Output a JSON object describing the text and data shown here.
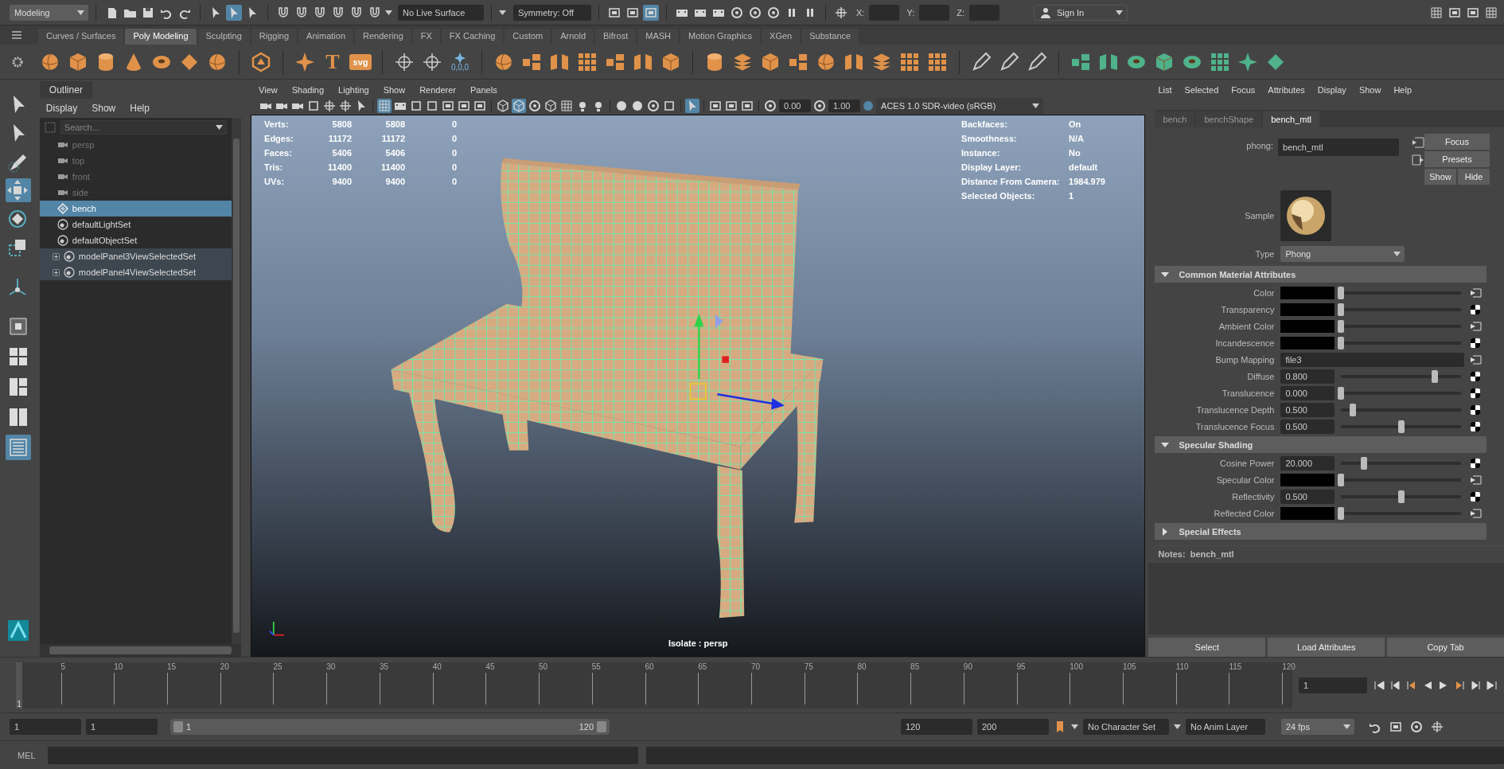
{
  "status_line": {
    "workspace": "Modeling",
    "select_tools": [
      {
        "selected": false
      },
      {
        "selected": true
      },
      {
        "selected": false
      }
    ],
    "live_surface": "No Live Surface",
    "symmetry": "Symmetry: Off",
    "panel_tools": [
      {
        "selected": false
      },
      {
        "selected": false
      },
      {
        "selected": true
      }
    ],
    "coordinates": [
      {
        "label": "X:"
      },
      {
        "label": "Y:"
      },
      {
        "label": "Z:"
      }
    ],
    "sign_in": "Sign In"
  },
  "shelf": {
    "tabs": [
      {
        "label": "Curves / Surfaces",
        "selected": false
      },
      {
        "label": "Poly Modeling",
        "selected": true
      },
      {
        "label": "Sculpting",
        "selected": false
      },
      {
        "label": "Rigging",
        "selected": false
      },
      {
        "label": "Animation",
        "selected": false
      },
      {
        "label": "Rendering",
        "selected": false
      },
      {
        "label": "FX",
        "selected": false
      },
      {
        "label": "FX Caching",
        "selected": false
      },
      {
        "label": "Custom",
        "selected": false
      },
      {
        "label": "Arnold",
        "selected": false
      },
      {
        "label": "Bifrost",
        "selected": false
      },
      {
        "label": "MASH",
        "selected": false
      },
      {
        "label": "Motion Graphics",
        "selected": false
      },
      {
        "label": "XGen",
        "selected": false
      },
      {
        "label": "Substance",
        "selected": false
      }
    ],
    "text_buttons": [
      "T",
      "svg",
      "0,0,0"
    ]
  },
  "toolbox": {
    "tools": [
      {
        "selected": false
      },
      {
        "selected": false
      },
      {
        "selected": false
      },
      {
        "selected": true
      },
      {
        "selected": false
      },
      {
        "selected": false
      },
      {
        "selected": false
      }
    ],
    "layouts": [
      {
        "selected": false
      },
      {
        "selected": false
      },
      {
        "selected": false
      },
      {
        "selected": false
      },
      {
        "selected": true
      }
    ]
  },
  "outliner": {
    "title": "Outliner",
    "menu": [
      "Display",
      "Show",
      "Help"
    ],
    "search": {
      "placeholder": "Search..."
    },
    "items": [
      {
        "label": "persp",
        "kind": "camera",
        "dimmed": true,
        "expandable": false,
        "selected": false
      },
      {
        "label": "top",
        "kind": "camera",
        "dimmed": true,
        "expandable": false,
        "selected": false
      },
      {
        "label": "front",
        "kind": "camera",
        "dimmed": true,
        "expandable": false,
        "selected": false
      },
      {
        "label": "side",
        "kind": "camera",
        "dimmed": true,
        "expandable": false,
        "selected": false
      },
      {
        "label": "bench",
        "kind": "mesh",
        "dimmed": false,
        "expandable": false,
        "selected": true
      },
      {
        "label": "defaultLightSet",
        "kind": "set",
        "dimmed": false,
        "expandable": false,
        "selected": false
      },
      {
        "label": "defaultObjectSet",
        "kind": "set",
        "dimmed": false,
        "expandable": false,
        "selected": false
      },
      {
        "label": "modelPanel3ViewSelectedSet",
        "kind": "set",
        "dimmed": false,
        "expandable": true,
        "selected": false
      },
      {
        "label": "modelPanel4ViewSelectedSet",
        "kind": "set",
        "dimmed": false,
        "expandable": true,
        "selected": false
      }
    ]
  },
  "viewport": {
    "menu": [
      "View",
      "Shading",
      "Lighting",
      "Show",
      "Renderer",
      "Panels"
    ],
    "toolbar": [
      {
        "selected": false
      },
      {
        "selected": false
      },
      {
        "selected": false
      },
      {
        "selected": false
      },
      {
        "selected": false
      },
      {
        "selected": false
      },
      {
        "selected": false
      },
      {
        "selected": true
      },
      {
        "selected": false
      },
      {
        "selected": false
      },
      {
        "selected": false
      },
      {
        "selected": false
      },
      {
        "selected": false
      },
      {
        "selected": false
      },
      {
        "selected": false
      },
      {
        "selected": true
      },
      {
        "selected": false
      },
      {
        "selected": false
      },
      {
        "selected": false
      },
      {
        "selected": false
      },
      {
        "selected": false
      },
      {
        "selected": false
      },
      {
        "selected": false
      },
      {
        "selected": false
      },
      {
        "selected": false
      },
      {
        "selected": true
      },
      {
        "selected": false
      },
      {
        "selected": false
      },
      {
        "selected": false
      },
      {
        "selected": false
      }
    ],
    "exposure": "0.00",
    "gamma": "1.00",
    "color_space": "ACES 1.0 SDR-video (sRGB)",
    "hud_left": [
      {
        "label": "Verts:",
        "values": [
          "5808",
          "5808",
          "0"
        ]
      },
      {
        "label": "Edges:",
        "values": [
          "11172",
          "11172",
          "0"
        ]
      },
      {
        "label": "Faces:",
        "values": [
          "5406",
          "5406",
          "0"
        ]
      },
      {
        "label": "Tris:",
        "values": [
          "11400",
          "11400",
          "0"
        ]
      },
      {
        "label": "UVs:",
        "values": [
          "9400",
          "9400",
          "0"
        ]
      }
    ],
    "hud_right": [
      {
        "label": "Backfaces:",
        "value": "On"
      },
      {
        "label": "Smoothness:",
        "value": "N/A"
      },
      {
        "label": "Instance:",
        "value": "No"
      },
      {
        "label": "Display Layer:",
        "value": "default"
      },
      {
        "label": "Distance From Camera:",
        "value": "1984.979"
      },
      {
        "label": "Selected Objects:",
        "value": "1"
      }
    ],
    "isolate": "Isolate : persp"
  },
  "attribute_editor": {
    "menu": [
      "List",
      "Selected",
      "Focus",
      "Attributes",
      "Display",
      "Show",
      "Help"
    ],
    "tabs": [
      {
        "label": "bench",
        "selected": false
      },
      {
        "label": "benchShape",
        "selected": false
      },
      {
        "label": "bench_mtl",
        "selected": true
      }
    ],
    "node_type": "phong:",
    "node_name": "bench_mtl",
    "buttons": [
      "Focus",
      "Presets",
      "Show",
      "Hide"
    ],
    "sample_label": "Sample",
    "type_label": "Type",
    "type_value": "Phong",
    "sections": [
      {
        "title": "Common Material Attributes",
        "expanded": true,
        "attributes": [
          {
            "label": "Color",
            "kind": "color",
            "color": "#000000",
            "level": 0,
            "connected": true
          },
          {
            "label": "Transparency",
            "kind": "color",
            "color": "#000000",
            "level": 0,
            "connected": false
          },
          {
            "label": "Ambient Color",
            "kind": "color",
            "color": "#000000",
            "level": 0,
            "connected": true
          },
          {
            "label": "Incandescence",
            "kind": "color",
            "color": "#000000",
            "level": 0,
            "connected": false
          },
          {
            "label": "Bump Mapping",
            "kind": "map",
            "value": "file3",
            "connected": true
          },
          {
            "label": "Diffuse",
            "kind": "number",
            "value": "0.800",
            "level": 0.78,
            "connected": false
          },
          {
            "label": "Translucence",
            "kind": "number",
            "value": "0.000",
            "level": 0,
            "connected": false
          },
          {
            "label": "Translucence Depth",
            "kind": "number",
            "value": "0.500",
            "level": 0.1,
            "connected": false
          },
          {
            "label": "Translucence Focus",
            "kind": "number",
            "value": "0.500",
            "level": 0.5,
            "connected": false
          }
        ]
      },
      {
        "title": "Specular Shading",
        "expanded": true,
        "attributes": [
          {
            "label": "Cosine Power",
            "kind": "number",
            "value": "20.000",
            "level": 0.19,
            "connected": false
          },
          {
            "label": "Specular Color",
            "kind": "color",
            "color": "#000000",
            "level": 0,
            "connected": true
          },
          {
            "label": "Reflectivity",
            "kind": "number",
            "value": "0.500",
            "level": 0.5,
            "connected": false
          },
          {
            "label": "Reflected Color",
            "kind": "color",
            "color": "#000000",
            "level": 0,
            "connected": true
          }
        ]
      },
      {
        "title": "Special Effects",
        "expanded": false
      }
    ],
    "notes_label": "Notes:",
    "notes_value": "bench_mtl",
    "bottom_buttons": [
      "Select",
      "Load Attributes",
      "Copy Tab"
    ]
  },
  "time_slider": {
    "level": 0,
    "ticks": [
      "5",
      "10",
      "15",
      "20",
      "25",
      "30",
      "35",
      "40",
      "45",
      "50",
      "55",
      "60",
      "65",
      "70",
      "75",
      "80",
      "85",
      "90",
      "95",
      "100",
      "105",
      "110",
      "115",
      "120"
    ],
    "current_marker": "1",
    "current_frame": "1"
  },
  "range_slider": {
    "level": 1,
    "start": "1",
    "playback_start": "1",
    "bar_start": "1",
    "bar_end": "120",
    "playback_end": "120",
    "end": "200",
    "character_set": "No Character Set",
    "anim_layer": "No Anim Layer",
    "fps": "24 fps"
  },
  "command_line": {
    "language": "MEL"
  }
}
